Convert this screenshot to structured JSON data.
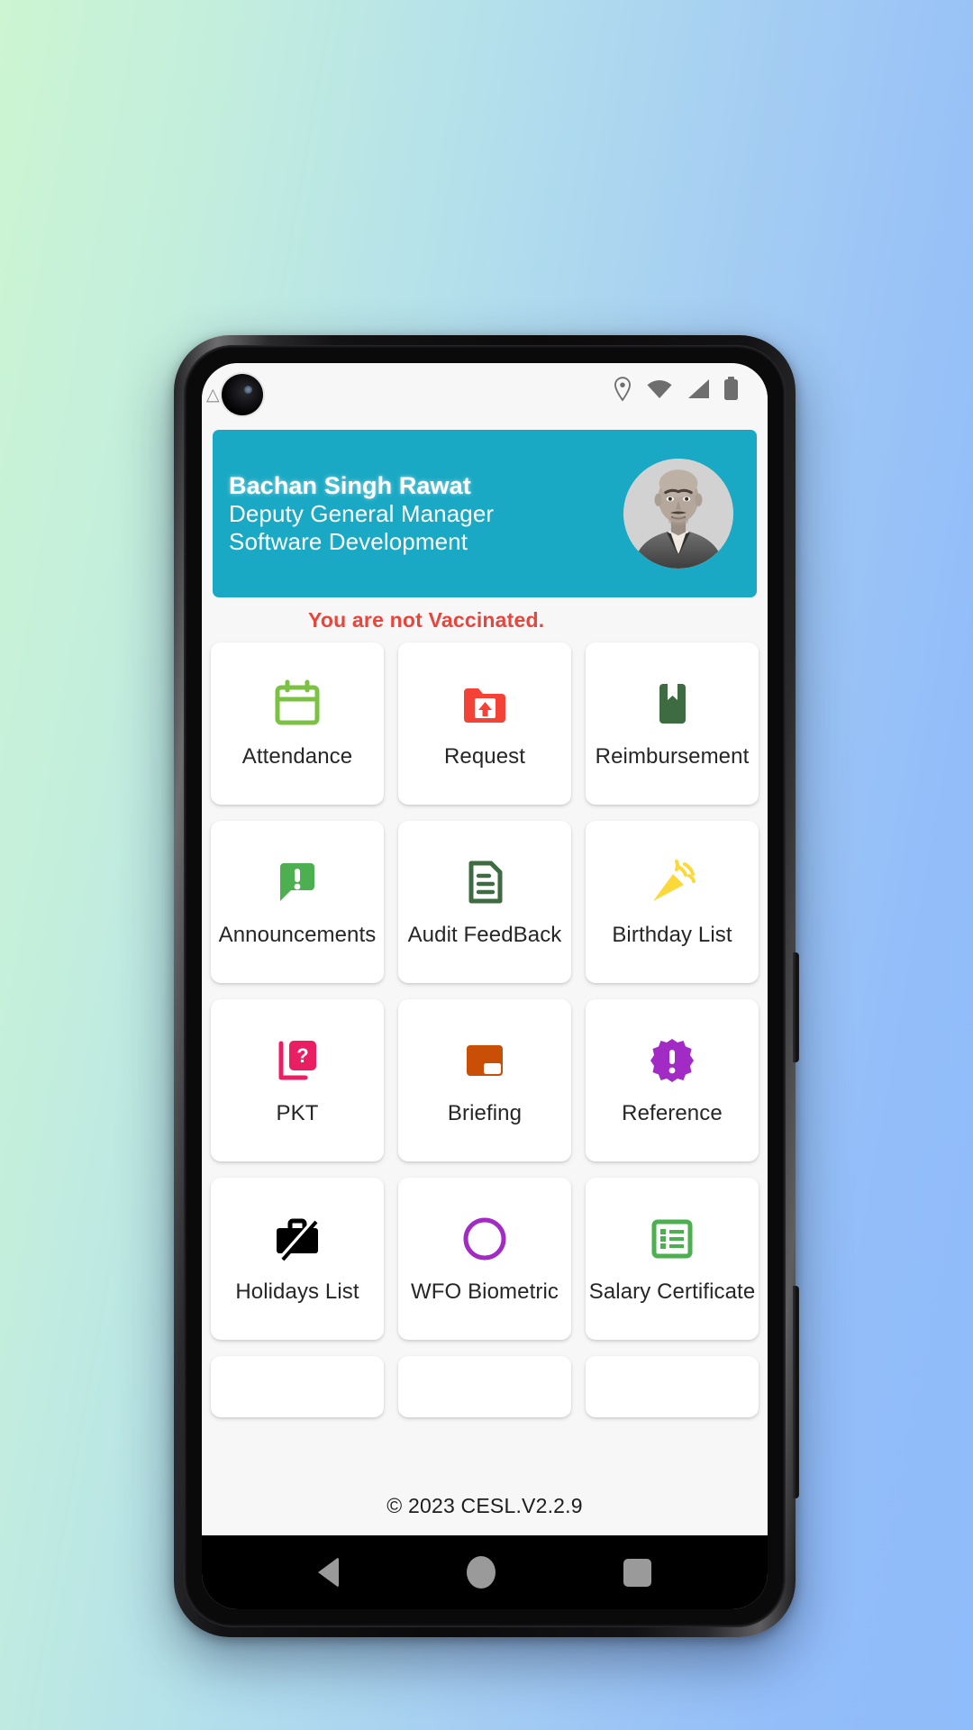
{
  "background": {
    "gradient_from": "#ccf5d2",
    "gradient_to": "#92bdf9"
  },
  "status_bar": {
    "icons": [
      "location-pin-icon",
      "wifi-icon",
      "cellular-signal-icon",
      "battery-icon"
    ]
  },
  "profile": {
    "name": "Bachan Singh Rawat",
    "designation": "Deputy General Manager",
    "department": "Software Development",
    "avatar_alt": "employee-photo",
    "accent_color": "#1aa9c4"
  },
  "notice": {
    "text": "You are not Vaccinated.",
    "repeat_text": "You ar",
    "color": "#e8453c"
  },
  "tiles": [
    {
      "label": "Attendance",
      "icon": "calendar-icon",
      "color": "#7cc242"
    },
    {
      "label": "Request",
      "icon": "folder-upload-icon",
      "color": "#f44336"
    },
    {
      "label": "Reimbursement",
      "icon": "bookmark-book-icon",
      "color": "#3f6b42"
    },
    {
      "label": "Announcements",
      "icon": "announcement-bubble-icon",
      "color": "#4caf50"
    },
    {
      "label": "Audit FeedBack",
      "icon": "document-lines-icon",
      "color": "#3f6b42"
    },
    {
      "label": "Birthday List",
      "icon": "party-popper-icon",
      "color": "#fcd93a"
    },
    {
      "label": "PKT",
      "icon": "quiz-cards-icon",
      "color": "#e91e63"
    },
    {
      "label": "Briefing",
      "icon": "presentation-board-icon",
      "color": "#c94f06"
    },
    {
      "label": "Reference",
      "icon": "starburst-alert-icon",
      "color": "#a12bc4"
    },
    {
      "label": "Holidays List",
      "icon": "briefcase-off-icon",
      "color": "#000000"
    },
    {
      "label": "WFO Biometric",
      "icon": "circle-ring-icon",
      "color": "#a12bc4"
    },
    {
      "label": "Salary Certificate",
      "icon": "list-checklist-icon",
      "color": "#4caf50"
    }
  ],
  "partial_tiles": [
    {
      "label": ""
    },
    {
      "label": ""
    },
    {
      "label": ""
    }
  ],
  "footer": {
    "text": "© 2023 CESL.V2.2.9"
  },
  "nav_bar": {
    "back": "back-button",
    "home": "home-button",
    "recents": "recents-button"
  }
}
